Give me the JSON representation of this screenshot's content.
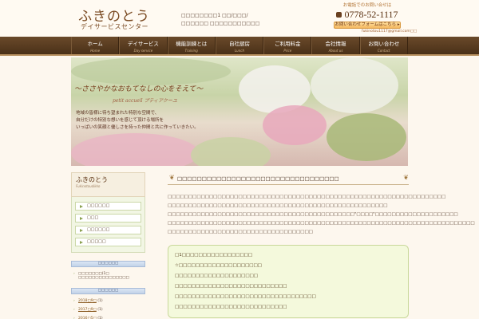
{
  "header": {
    "logo": "ふきのとう",
    "logo_sub": "デイサービスセンター",
    "address_line1": "□□□□□□□□1 □□/□□□/",
    "address_line2": "□□□□□□ □□□□□□□□□□□",
    "contact_caption": "お電話でのお問い合せは",
    "phone": "0778-52-1117",
    "contact_button": "お問い合わせフォームはこちら ▸",
    "email": "fukinotou1117@gmail.com□□"
  },
  "nav": [
    {
      "label": "ホーム",
      "sub": "Home"
    },
    {
      "label": "デイサービス",
      "sub": "Day service"
    },
    {
      "label": "機能訓練とは",
      "sub": "Training"
    },
    {
      "label": "自社厨房",
      "sub": "Lunch"
    },
    {
      "label": "ご利用料金",
      "sub": "Price"
    },
    {
      "label": "会社情報",
      "sub": "About us"
    },
    {
      "label": "お問い合わせ",
      "sub": "Contact"
    }
  ],
  "hero": {
    "title": "〜ささやかなおもてなしの心をそえて〜",
    "subtitle": "petit accueil プティアクーユ",
    "body": "地域の皆様に待ち望まれた特別な空間で、\n自分だけの特別な想いを感じて頂ける場所を\nいっぱいの笑顔と優しさを持った仲間と共に作っていきたい。"
  },
  "sidebar": {
    "title": "ふきのとう",
    "title_sub": "Fukinotoudikko",
    "menu": [
      "□□□□□□",
      "□□□",
      "□□□□□□",
      "□□□□□"
    ],
    "recent_header": "□□□□□□",
    "recent_link": "□□□□□□□(1□ □□□□□□□□□□□□□□□",
    "archive_header": "□□□□□□",
    "archives": [
      {
        "label": "2018□9□",
        "count": "(1)"
      },
      {
        "label": "2017□9□",
        "count": "(1)"
      },
      {
        "label": "2016□5□",
        "count": "(1)"
      },
      {
        "label": "2015□9□",
        "count": "(1)"
      }
    ]
  },
  "main": {
    "title": "□□□□□□□□□□□□□□□□□□□□□□□□□□□□□□□□□",
    "paragraphs": [
      "□□□□□□□□□□□□□□□□□□□□□□□□□□□□□□□□□□□□□□□□□□□□□□□□□□□□□□□□□□□□□□□□□□□",
      "□□□□□□□□□□□□□□□□□□□□□□□□□□□□□□□□□□□□□□□□□□□□□□□□□□□□□",
      "□□□□□□□□□□□□□□□□□□□□□□□□□□□□□□□□□□□□□□□□□□□□□\"□□□□\"□□□□□□□□□□□□□□□□□□□□",
      "□□□□□□□□□□□□□□□□□□□□□□□□□□□□□□□□□□□□□□□□□□□□□□□□□□□□□□□□□□□□□□□□□□□□□□□□□□",
      "□□□□□□□□□□□□□□□□□□□□□□□□□□□□□□□□□□□"
    ],
    "box_lines": [
      "□1□□□□□□□□□□□□□□□□□",
      "☆□□□□□□□□□□□□□□□□□□□□",
      "□□□□□□□□□□□□□□□□□□□□",
      "□□□□□□□□□□□□□□□□□□□□□□□□□□□",
      "□□□□□□□□□□□□□□□□□□□□□□□□□□□□□□□□□□",
      "□□□□□□□□□□□□□□□□□□□□□□□□□□□"
    ]
  }
}
